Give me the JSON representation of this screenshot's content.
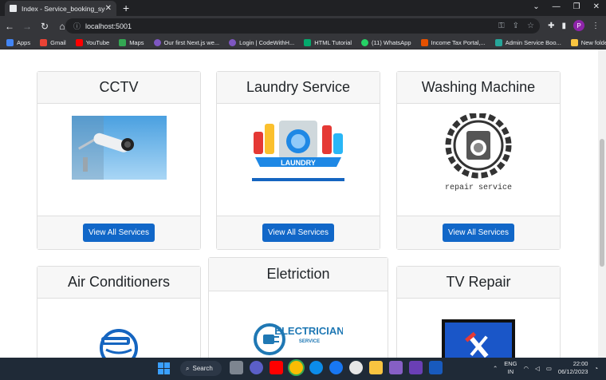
{
  "browser": {
    "tab_title": "Index - Service_booking_system",
    "url": "localhost:5001",
    "profile_initial": "P"
  },
  "bookmarks": [
    {
      "label": "Apps",
      "color": "#4285f4"
    },
    {
      "label": "Gmail",
      "color": "#ea4335"
    },
    {
      "label": "YouTube",
      "color": "#ff0000"
    },
    {
      "label": "Maps",
      "color": "#34a853"
    },
    {
      "label": "Our first Next.js we...",
      "color": "#7e57c2"
    },
    {
      "label": "Login | CodeWithH...",
      "color": "#7e57c2"
    },
    {
      "label": "HTML Tutorial",
      "color": "#04aa6d"
    },
    {
      "label": "(11) WhatsApp",
      "color": "#25d366"
    },
    {
      "label": "Income Tax Portal,...",
      "color": "#e65100"
    },
    {
      "label": "Admin Service Boo...",
      "color": "#26a69a"
    },
    {
      "label": "New folder",
      "color": "#f9c440"
    }
  ],
  "cards": [
    {
      "title": "CCTV",
      "button": "View All Services",
      "image": "cctv-camera"
    },
    {
      "title": "Laundry Service",
      "button": "View All Services",
      "image": "laundry",
      "image_text": "LAUNDRY"
    },
    {
      "title": "Washing Machine",
      "button": "View All Services",
      "image": "washing-machine-repair",
      "image_text": "repair service"
    },
    {
      "title": "Air Conditioners",
      "image": "air-conditioner"
    },
    {
      "title": "Eletriction",
      "image": "electrician-logo",
      "image_text": "ELECTRICIAN",
      "image_subtext": "SERVICE"
    },
    {
      "title": "TV Repair",
      "image": "tv-repair"
    }
  ],
  "taskbar": {
    "search_label": "Search",
    "language": "ENG",
    "region": "IN",
    "time": "22:00",
    "date": "06/12/2023"
  },
  "colors": {
    "button": "#1167c8",
    "card_header": "#f7f7f7"
  }
}
